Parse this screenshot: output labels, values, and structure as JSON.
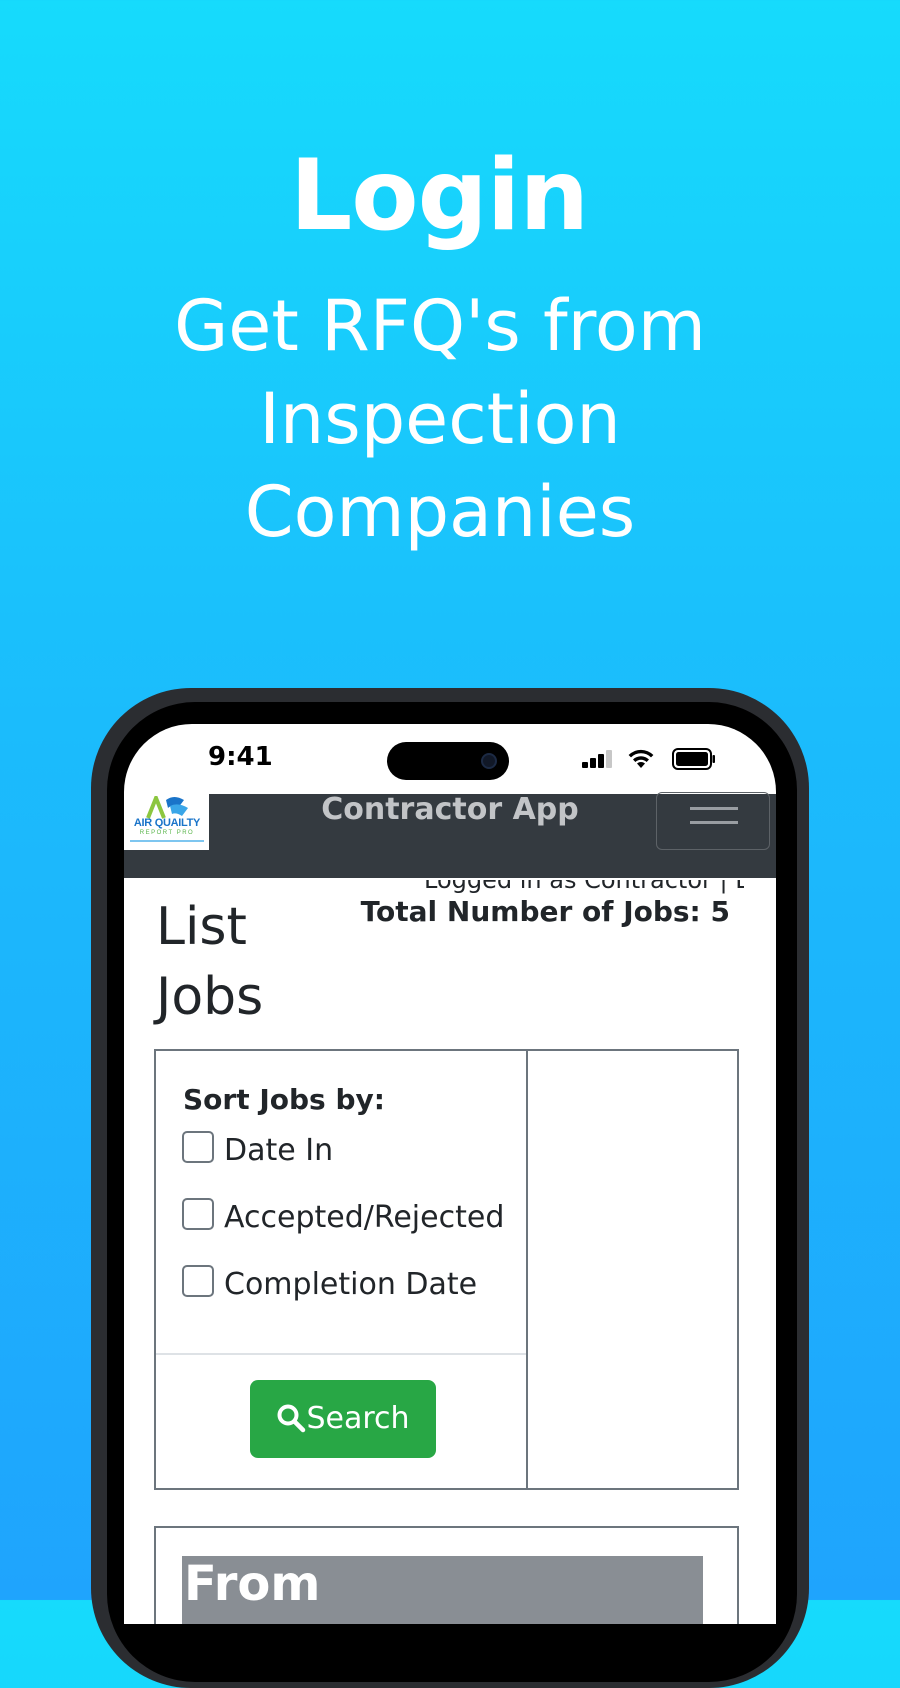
{
  "hero": {
    "title": "Login",
    "subtitle": "Get RFQ's from Inspection Companies"
  },
  "status_bar": {
    "time": "9:41"
  },
  "app": {
    "logo": {
      "name": "AIR QUAILTY",
      "tagline": "REPORT PRO"
    },
    "title": "Contractor App",
    "menu_icon": "hamburger-icon"
  },
  "page": {
    "clipped_line": "Logged in as Contractor | Logout | Log",
    "heading": "List Jobs",
    "total_jobs": "Total Number of Jobs: 5"
  },
  "sort": {
    "heading": "Sort Jobs by:",
    "options": [
      {
        "label": "Date In",
        "checked": false
      },
      {
        "label": "Accepted/Rejected",
        "checked": false
      },
      {
        "label": "Completion Date",
        "checked": false
      }
    ],
    "search_label": "Search",
    "search_icon": "search-icon"
  },
  "table": {
    "columns": [
      "From"
    ]
  },
  "colors": {
    "background_top": "#16dbfc",
    "background_bottom": "#1fa4fd",
    "header_bg": "#343a40",
    "search_button": "#28a745",
    "table_header": "#898e94"
  }
}
